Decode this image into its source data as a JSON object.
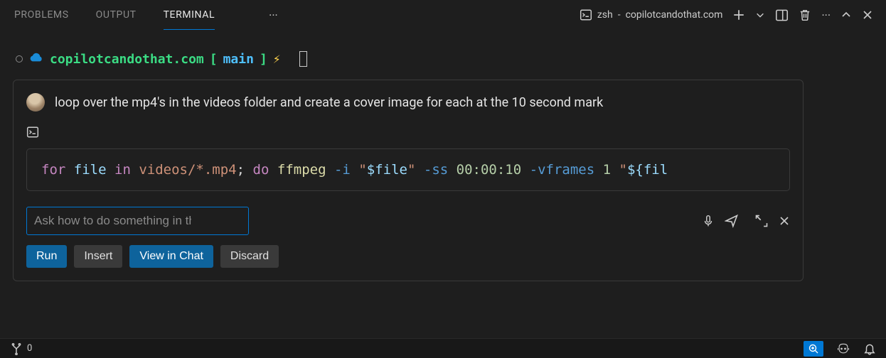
{
  "tabs": {
    "problems": "PROBLEMS",
    "output": "OUTPUT",
    "terminal": "TERMINAL"
  },
  "terminal_tab": {
    "shell": "zsh",
    "dash": " - ",
    "host": "copilotcandothat.com"
  },
  "prompt": {
    "host": "copilotcandothat.com",
    "branch_open": "[",
    "branch": "main",
    "branch_close": "]",
    "bolt": "⚡"
  },
  "chat": {
    "user_msg": "loop over the mp4's in the videos folder and create a cover image for each at the 10 second mark",
    "code": {
      "for": "for",
      "file": "file",
      "in": "in",
      "path": "videos/*.mp4",
      "semi": ";",
      "do": "do",
      "ffmpeg": "ffmpeg",
      "i": "-i",
      "q1": "\"",
      "var1": "$file",
      "q2": "\"",
      "ss": "-ss",
      "time": "00:00:10",
      "vframes": "-vframes",
      "one": "1",
      "q3": "\"",
      "var2": "${fil",
      "tail": ""
    },
    "input_placeholder": "Ask how to do something in the terminal",
    "buttons": {
      "run": "Run",
      "insert": "Insert",
      "view": "View in Chat",
      "discard": "Discard"
    }
  },
  "status": {
    "ports": "0"
  }
}
